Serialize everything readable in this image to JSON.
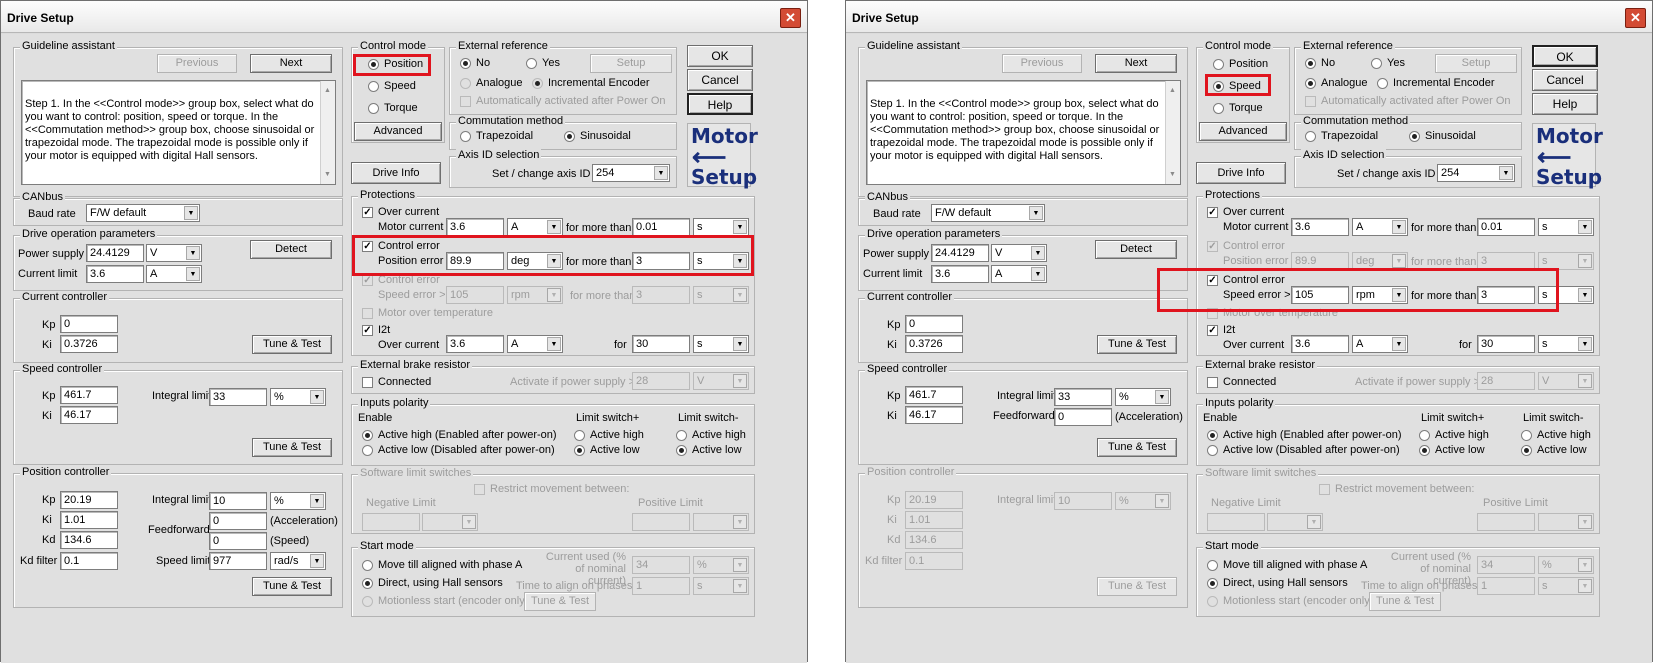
{
  "window_title": "Drive Setup",
  "close_symbol": "✕",
  "colors": {
    "highlight": "#e0141e",
    "logo": "#1a2f7b"
  },
  "icons": [
    "close-icon",
    "dropdown-arrow-icon",
    "left-arrow-icon",
    "scroll-up-icon",
    "scroll-down-icon"
  ],
  "glyphs": {
    "dropdown": "▼",
    "arrow": "⟵",
    "check": "✓",
    "scroll_up": "▲",
    "scroll_down": "▼"
  },
  "guideline": {
    "label": "Guideline assistant",
    "previous": "Previous",
    "next": "Next",
    "text": "Step 1.    In the <<Control mode>> group box, select what do you want to control: position, speed or torque.  In the <<Commutation method>> group box, choose sinusoidal or trapezoidal mode. The trapezoidal mode is possible only if your motor is equipped with digital Hall sensors."
  },
  "control_mode": {
    "label": "Control mode",
    "position": "Position",
    "speed": "Speed",
    "torque": "Torque",
    "advanced": "Advanced"
  },
  "external_reference": {
    "label": "External reference",
    "no": "No",
    "yes": "Yes",
    "setup": "Setup",
    "analogue": "Analogue",
    "incremental": "Incremental Encoder",
    "auto": "Automatically activated after Power On"
  },
  "commutation": {
    "label": "Commutation method",
    "trapezoidal": "Trapezoidal",
    "sinusoidal": "Sinusoidal"
  },
  "buttons": {
    "ok": "OK",
    "cancel": "Cancel",
    "help": "Help",
    "drive_info": "Drive Info",
    "detect": "Detect",
    "tune_test": "Tune & Test"
  },
  "logo": {
    "line1": "Motor",
    "line2": "Setup"
  },
  "axis": {
    "label": "Axis ID selection",
    "set_label": "Set / change axis ID",
    "value": "254"
  },
  "canbus": {
    "label": "CANbus",
    "baud_label": "Baud rate",
    "baud_value": "F/W default"
  },
  "drive_params": {
    "label": "Drive operation parameters",
    "power_label": "Power supply",
    "power_value": "24.4129",
    "power_unit": "V",
    "current_label": "Current limit",
    "current_value": "3.6",
    "current_unit": "A"
  },
  "current_controller": {
    "label": "Current controller",
    "kp_label": "Kp",
    "kp": "0",
    "ki_label": "Ki",
    "ki": "0.3726"
  },
  "speed_controller": {
    "label": "Speed controller",
    "kp_label": "Kp",
    "kp": "461.7",
    "ki_label": "Ki",
    "ki": "46.17",
    "int_label": "Integral limit",
    "int_value": "33",
    "int_unit": "%",
    "ff_label": "Feedforward",
    "ff_value": "0",
    "ff_unit": "(Acceleration)"
  },
  "position_controller": {
    "label": "Position controller",
    "kp_label": "Kp",
    "kp": "20.19",
    "ki_label": "Ki",
    "ki": "1.01",
    "kd_label": "Kd",
    "kd": "134.6",
    "kdf_label": "Kd filter",
    "kdf": "0.1",
    "int_label": "Integral limit",
    "int_value": "10",
    "int_unit": "%",
    "ff_label": "Feedforward",
    "ff1": "0",
    "ff1_unit": "(Acceleration)",
    "ff2": "0",
    "ff2_unit": "(Speed)",
    "sl_label": "Speed limit",
    "sl_value": "977",
    "sl_unit": "rad/s"
  },
  "protections": {
    "label": "Protections",
    "oc_label": "Over current",
    "oc_sub": "Motor current >",
    "oc_value": "3.6",
    "oc_unit": "A",
    "fmt": "for more than",
    "oc_time": "0.01",
    "time_unit": "s",
    "ce_label": "Control error",
    "ce_pos_sub": "Position error >",
    "ce_pos_value": "89.9",
    "ce_pos_unit": "deg",
    "ce_pos_time": "3",
    "ce_speed_sub": "Speed error >",
    "ce_speed_value": "105",
    "ce_speed_unit": "rpm",
    "ce_speed_time": "3",
    "mot_label": "Motor over temperature",
    "i2t_label": "I2t",
    "i2t_sub": "Over current",
    "i2t_value": "3.6",
    "i2t_unit": "A",
    "for_label": "for",
    "i2t_time": "30"
  },
  "brake": {
    "label": "External brake resistor",
    "connected": "Connected",
    "activate": "Activate if power supply >",
    "value": "28",
    "unit": "V"
  },
  "inputs": {
    "label": "Inputs polarity",
    "enable": "Enable",
    "active_high_en": "Active high (Enabled after power-on)",
    "active_low_dis": "Active low (Disabled after power-on)",
    "ls_plus": "Limit switch+",
    "ls_minus": "Limit switch-",
    "active_high": "Active high",
    "active_low": "Active low"
  },
  "software_limits": {
    "label": "Software limit switches",
    "neg": "Negative Limit",
    "pos": "Positive Limit",
    "restrict": "Restrict movement between:"
  },
  "start_mode": {
    "label": "Start mode",
    "move": "Move till aligned with phase A",
    "direct": "Direct, using Hall sensors",
    "motionless": "Motionless start (encoder only)",
    "current_used": "Current used (% of nominal current)",
    "cu_value": "34",
    "cu_unit": "%",
    "time_align": "Time to align on phases",
    "ta_value": "1",
    "ta_unit": "s"
  }
}
